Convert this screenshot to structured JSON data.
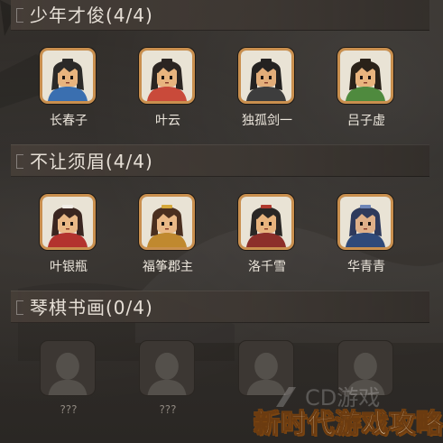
{
  "sections": [
    {
      "title": "少年才俊(4/4)",
      "heroes": [
        {
          "name": "长春子",
          "unlocked": true,
          "hair": "#2c2a28",
          "skin": "#e8b47e",
          "cloth": "#3a6fb0",
          "accent": "#2c2a28"
        },
        {
          "name": "叶云",
          "unlocked": true,
          "hair": "#2b2522",
          "skin": "#e8b47e",
          "cloth": "#c94a3a",
          "accent": "#2b2522"
        },
        {
          "name": "独孤剑一",
          "unlocked": true,
          "hair": "#242221",
          "skin": "#e2ad79",
          "cloth": "#3d3d3d",
          "accent": "#242221"
        },
        {
          "name": "吕子虚",
          "unlocked": true,
          "hair": "#2a2219",
          "skin": "#e8b47e",
          "cloth": "#4f8a3e",
          "accent": "#2a2219"
        }
      ]
    },
    {
      "title": "不让须眉(4/4)",
      "heroes": [
        {
          "name": "叶银瓶",
          "unlocked": true,
          "hair": "#3a2620",
          "skin": "#eab987",
          "cloth": "#b3332e",
          "accent": "#f1ede6"
        },
        {
          "name": "福筝郡主",
          "unlocked": true,
          "hair": "#4a2f1f",
          "skin": "#eab987",
          "cloth": "#c0892f",
          "accent": "#d5a83a"
        },
        {
          "name": "洛千雪",
          "unlocked": true,
          "hair": "#2a2725",
          "skin": "#e8b47e",
          "cloth": "#8c2f2a",
          "accent": "#b03a2e"
        },
        {
          "name": "华青青",
          "unlocked": true,
          "hair": "#2e3a5c",
          "skin": "#dfb089",
          "cloth": "#2f4a7a",
          "accent": "#6e86b8"
        }
      ]
    },
    {
      "title": "琴棋书画(0/4)",
      "heroes": [
        {
          "name": "???",
          "unlocked": false
        },
        {
          "name": "???",
          "unlocked": false
        },
        {
          "name": "",
          "unlocked": false
        },
        {
          "name": "",
          "unlocked": false
        }
      ]
    }
  ],
  "watermark": {
    "text": "新时代游戏攻略",
    "logo_text": "CD游戏"
  },
  "colors": {
    "frame": "#c98f4e",
    "background": "#2a2724",
    "text": "#ece6dc"
  }
}
